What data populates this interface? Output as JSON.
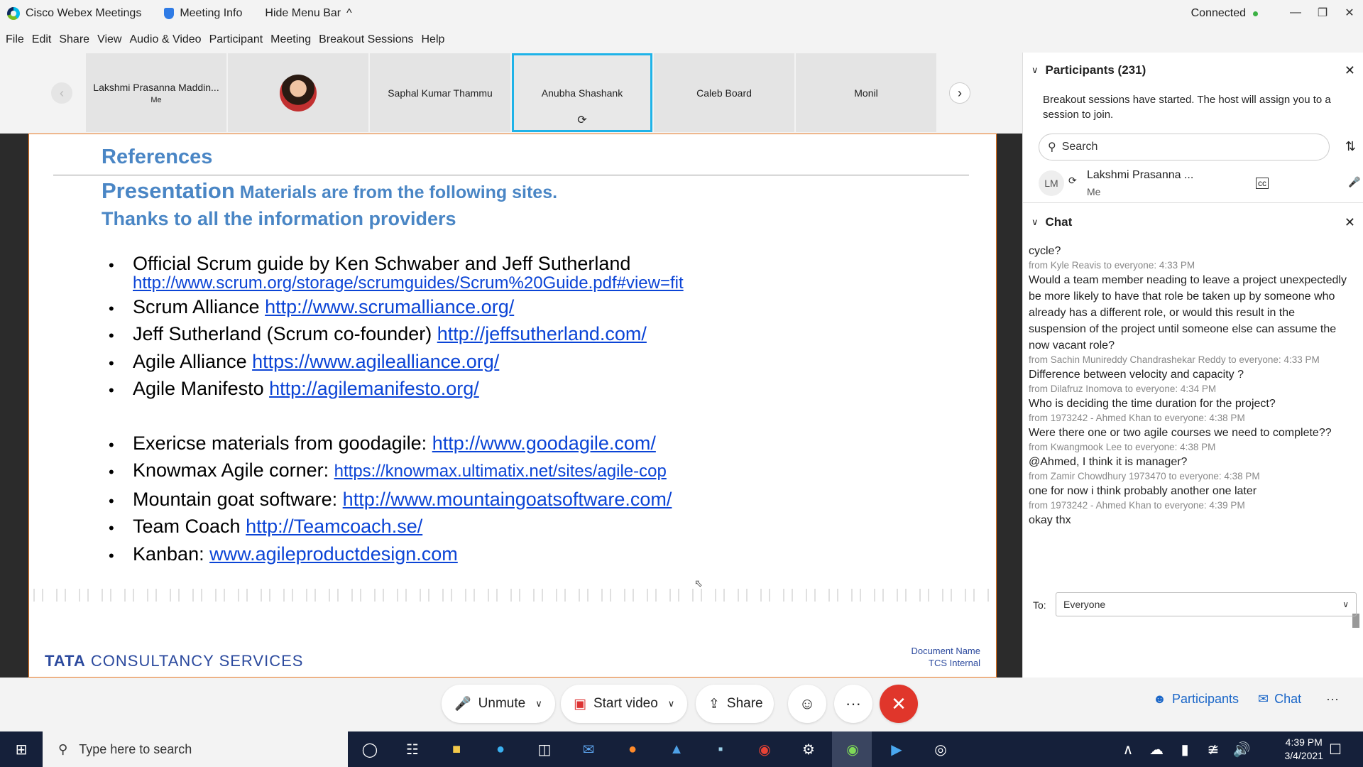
{
  "titlebar": {
    "app_title": "Cisco Webex Meetings",
    "meeting_info": "Meeting Info",
    "hide_menu": "Hide Menu Bar",
    "hide_menu_chevron": "^",
    "status": "Connected"
  },
  "menu": {
    "file": "File",
    "edit": "Edit",
    "share": "Share",
    "view": "View",
    "audio_video": "Audio & Video",
    "participant": "Participant",
    "meeting": "Meeting",
    "breakout": "Breakout Sessions",
    "help": "Help"
  },
  "strip": {
    "tiles": [
      {
        "name": "Lakshmi Prasanna Maddin...",
        "sub": "Me"
      },
      {
        "name": "",
        "sub": ""
      },
      {
        "name": "Saphal Kumar Thammu",
        "sub": ""
      },
      {
        "name": "Anubha Shashank",
        "sub": ""
      },
      {
        "name": "Caleb Board",
        "sub": ""
      },
      {
        "name": "Monil",
        "sub": ""
      }
    ],
    "active_index": 3
  },
  "slide": {
    "heading": "References",
    "line2_big": "Presentation",
    "line2_rest": " Materials are from the following sites.",
    "line3": "Thanks to all the information providers",
    "refs": [
      {
        "text": "Official Scrum guide by Ken Schwaber and Jeff Sutherland",
        "url": "http://www.scrum.org/storage/scrumguides/Scrum%20Guide.pdf#view=fit"
      },
      {
        "text": "Scrum Alliance ",
        "url": "http://www.scrumalliance.org/"
      },
      {
        "text": "Jeff Sutherland (Scrum co-founder) ",
        "url": "http://jeffsutherland.com/"
      },
      {
        "text": "Agile Alliance ",
        "url": "https://www.agilealliance.org/"
      },
      {
        "text": "Agile Manifesto ",
        "url": "http://agilemanifesto.org/"
      },
      {
        "text": "Exericse materials from goodagile: ",
        "url": "http://www.goodagile.com/"
      },
      {
        "text": "Knowmax Agile corner: ",
        "url": "https://knowmax.ultimatix.net/sites/agile-cop "
      },
      {
        "text": "Mountain goat software: ",
        "url": "http://www.mountaingoatsoftware.com/"
      },
      {
        "text": "Team Coach ",
        "url": "http://Teamcoach.se/"
      },
      {
        "text": "Kanban: ",
        "url": "www.agileproductdesign.com"
      }
    ],
    "brand_bold": "TATA",
    "brand_rest": " CONSULTANCY SERVICES",
    "doc_name": "Document Name",
    "doc_class": "TCS Internal"
  },
  "participants": {
    "title": "Participants (231)",
    "notice": "Breakout sessions have started. The host will assign you to a session to join.",
    "search_placeholder": "Search",
    "me": {
      "initials": "LM",
      "name": "Lakshmi Prasanna ...",
      "sub": "Me"
    }
  },
  "chat": {
    "title": "Chat",
    "messages": [
      {
        "from": "",
        "text": "cycle?"
      },
      {
        "from": "from Kyle Reavis to everyone:    4:33 PM",
        "text": "Would a team member neading to leave a project unexpectedly be more likely to have that role be taken up by someone who already has a different role, or would this result in the suspension of the project until someone else can assume the now vacant role?"
      },
      {
        "from": "from Sachin Munireddy Chandrashekar Reddy to everyone:    4:33 PM",
        "text": "Difference between velocity and capacity ?"
      },
      {
        "from": "from Dilafruz Inomova to everyone:    4:34 PM",
        "text": "Who is deciding the time duration for the project?"
      },
      {
        "from": "from 1973242 - Ahmed Khan to everyone:    4:38 PM",
        "text": "Were there one or two agile courses we need to complete??"
      },
      {
        "from": "from Kwangmook Lee to everyone:    4:38 PM",
        "text": "@Ahmed, I think it is manager?"
      },
      {
        "from": "from Zamir Chowdhury 1973470 to everyone:    4:38 PM",
        "text": "one for now i think probably another one later"
      },
      {
        "from": "from 1973242 - Ahmed Khan to everyone:    4:39 PM",
        "text": "okay thx"
      }
    ],
    "to_label": "To:",
    "to_value": "Everyone"
  },
  "controls": {
    "unmute": "Unmute",
    "start_video": "Start video",
    "share": "Share",
    "more": "···",
    "participants": "Participants",
    "chat": "Chat"
  },
  "taskbar": {
    "search_placeholder": "Type here to search",
    "time": "4:39 PM",
    "date": "3/4/2021"
  },
  "colors": {
    "accent": "#1fb3e8",
    "leave": "#e0362b",
    "slide_heading": "#4a86c5",
    "link": "#0b44d6",
    "taskbar": "#15203a"
  }
}
